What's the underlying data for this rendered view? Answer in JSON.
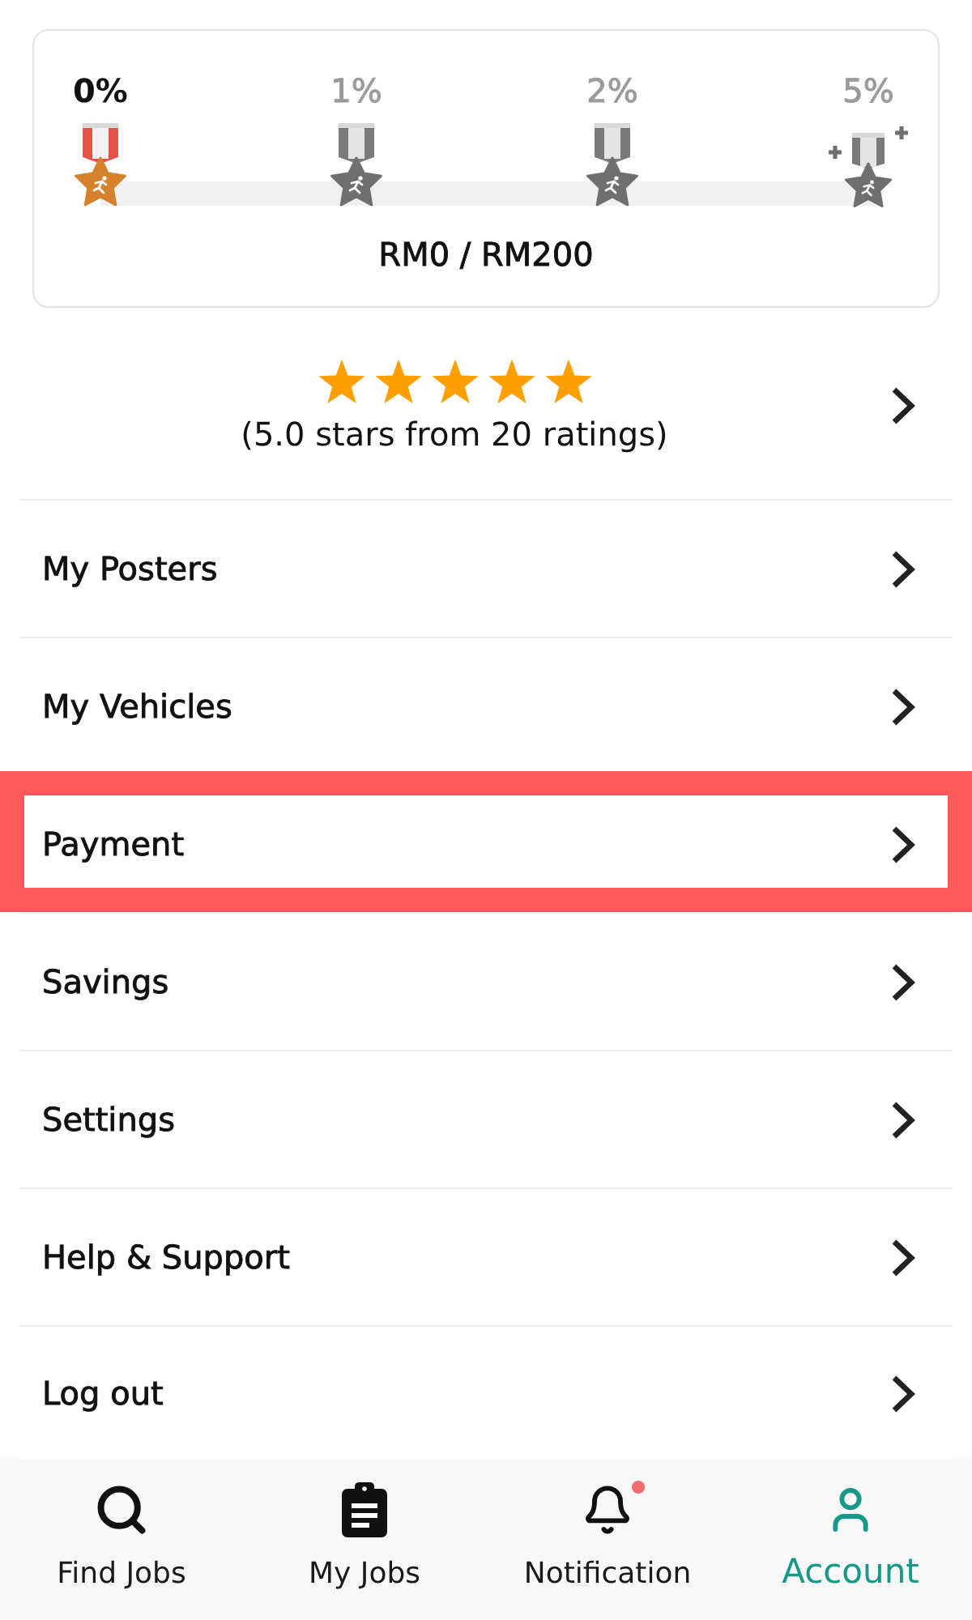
{
  "tiers": [
    {
      "percent": "0%",
      "achieved": true,
      "kind": "medal"
    },
    {
      "percent": "1%",
      "achieved": false,
      "kind": "medal"
    },
    {
      "percent": "2%",
      "achieved": false,
      "kind": "medal"
    },
    {
      "percent": "5%",
      "achieved": false,
      "kind": "medal-plus"
    }
  ],
  "savings_progress": {
    "label": "RM0 / RM200"
  },
  "rating": {
    "stars": 5,
    "summary": "(5.0 stars from 20 ratings)"
  },
  "menu": [
    {
      "label": "My Posters",
      "highlighted": false
    },
    {
      "label": "My Vehicles",
      "highlighted": false
    },
    {
      "label": "Payment",
      "highlighted": true
    },
    {
      "label": "Savings",
      "highlighted": false
    },
    {
      "label": "Settings",
      "highlighted": false
    },
    {
      "label": "Help & Support",
      "highlighted": false
    },
    {
      "label": "Log out",
      "highlighted": false
    }
  ],
  "bottom_nav": [
    {
      "label": "Find Jobs",
      "kind": "search",
      "selected": false,
      "unread": false
    },
    {
      "label": "My Jobs",
      "kind": "clipboard",
      "selected": false,
      "unread": false
    },
    {
      "label": "Notification",
      "kind": "bell",
      "selected": false,
      "unread": true
    },
    {
      "label": "Account",
      "kind": "person",
      "selected": true,
      "unread": false
    }
  ]
}
